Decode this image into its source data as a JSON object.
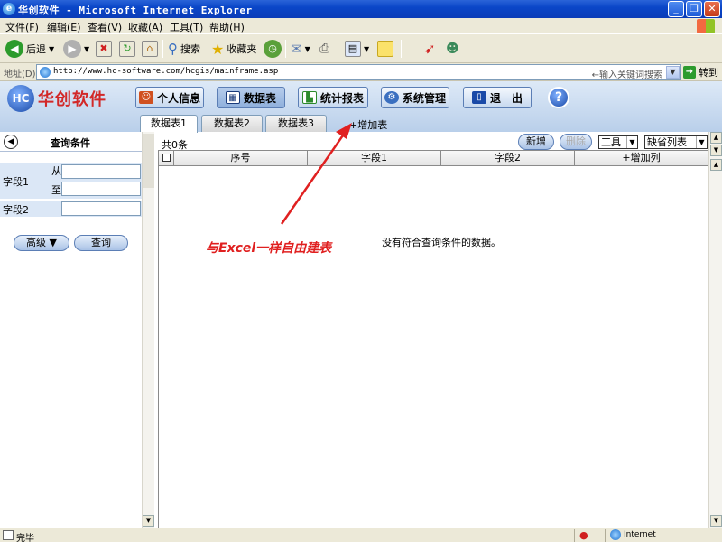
{
  "window": {
    "title": "华创软件 - Microsoft Internet Explorer",
    "buttons": [
      "_",
      "❐",
      "✕"
    ]
  },
  "menu": {
    "items": [
      "文件(F)",
      "编辑(E)",
      "查看(V)",
      "收藏(A)",
      "工具(T)",
      "帮助(H)"
    ]
  },
  "toolbar": {
    "back_label": "后退",
    "search_label": "搜索",
    "favorites_label": "收藏夹"
  },
  "address": {
    "label": "地址(D)",
    "url": "http://www.hc-software.com/hcgis/mainframe.asp",
    "keyword_hint": "←输入关键词搜索",
    "go_label": "转到"
  },
  "app": {
    "logo_text": "华创软件",
    "nav": [
      {
        "label": "个人信息"
      },
      {
        "label": "数据表"
      },
      {
        "label": "统计报表"
      },
      {
        "label": "系统管理"
      },
      {
        "label": "退　出"
      }
    ],
    "help": "?",
    "tabs": [
      "数据表1",
      "数据表2",
      "数据表3"
    ],
    "add_tab": "+增加表"
  },
  "query": {
    "title": "查询条件",
    "field1_label": "字段1",
    "from_label": "从",
    "to_label": "至",
    "field2_label": "字段2",
    "advanced_label": "高级 ▼",
    "search_label": "查询"
  },
  "grid": {
    "count_text": "共0条",
    "new_label": "新增",
    "delete_label": "删除",
    "tools_select": "工具",
    "view_select": "缺省列表",
    "columns": [
      "序号",
      "字段1",
      "字段2",
      "+增加列"
    ],
    "empty_text": "没有符合查询条件的数据。"
  },
  "annotation": {
    "text": "与Excel一样自由建表",
    "color": "#e02020"
  },
  "status": {
    "text": "完毕",
    "zone": "Internet"
  }
}
